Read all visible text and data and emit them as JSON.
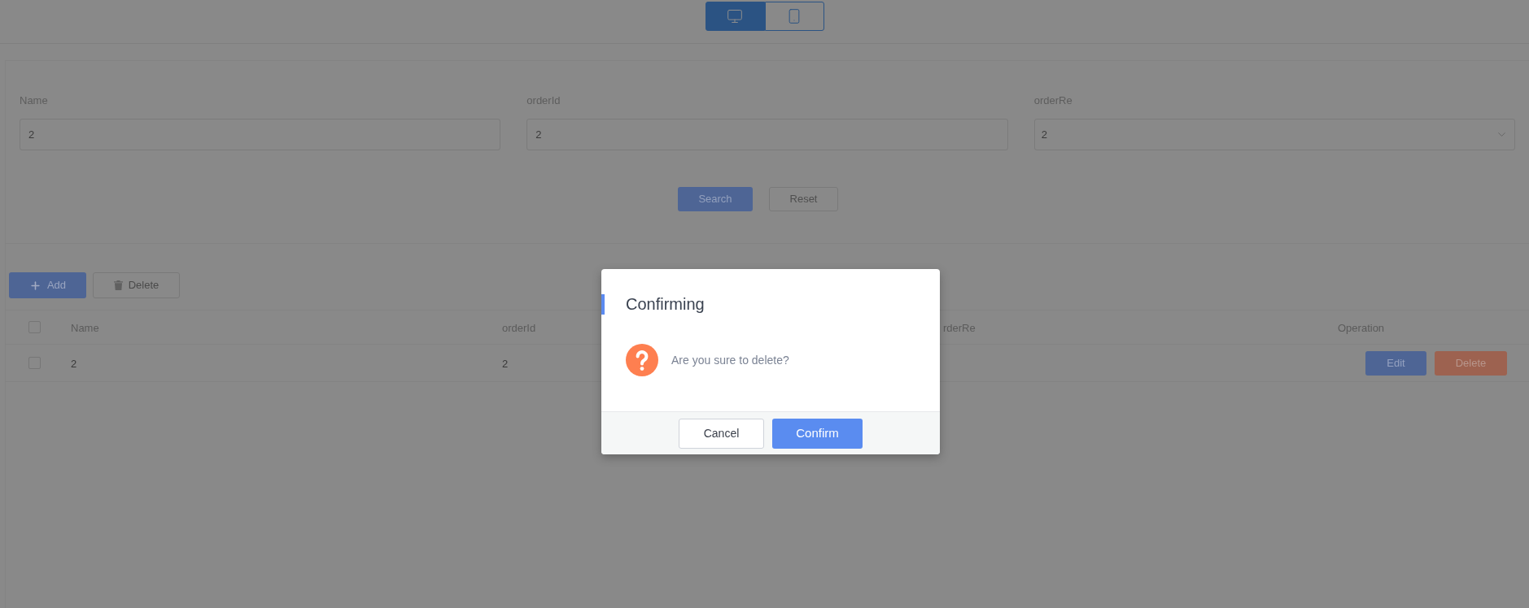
{
  "device_toggle": [
    {
      "kind": "desktop",
      "selected": true
    },
    {
      "kind": "mobile",
      "selected": false
    }
  ],
  "search_form": {
    "fields": [
      {
        "label": "Name",
        "value": "2",
        "kind": "input"
      },
      {
        "label": "orderId",
        "value": "2",
        "kind": "input"
      },
      {
        "label": "orderRe",
        "value": "2",
        "kind": "select"
      }
    ],
    "buttons": [
      {
        "label": "Search",
        "kind": "primary"
      },
      {
        "label": "Reset",
        "kind": "default"
      }
    ]
  },
  "toolbar": [
    {
      "label": "Add",
      "kind": "add"
    },
    {
      "label": "Delete",
      "kind": "delete"
    }
  ],
  "table": {
    "select_all_checked": false,
    "columns": [
      "Name",
      "orderId",
      "rderRe",
      "Operation"
    ],
    "rows": [
      {
        "checked": false,
        "cells": [
          "2",
          "2"
        ],
        "actions": [
          {
            "label": "Edit",
            "kind": "edit"
          },
          {
            "label": "Delete",
            "kind": "delete"
          }
        ]
      }
    ]
  },
  "dialog": {
    "title": "Confirming",
    "message": "Are you sure to delete?",
    "buttons": [
      {
        "label": "Cancel",
        "kind": "default"
      },
      {
        "label": "Confirm",
        "kind": "primary"
      }
    ]
  }
}
